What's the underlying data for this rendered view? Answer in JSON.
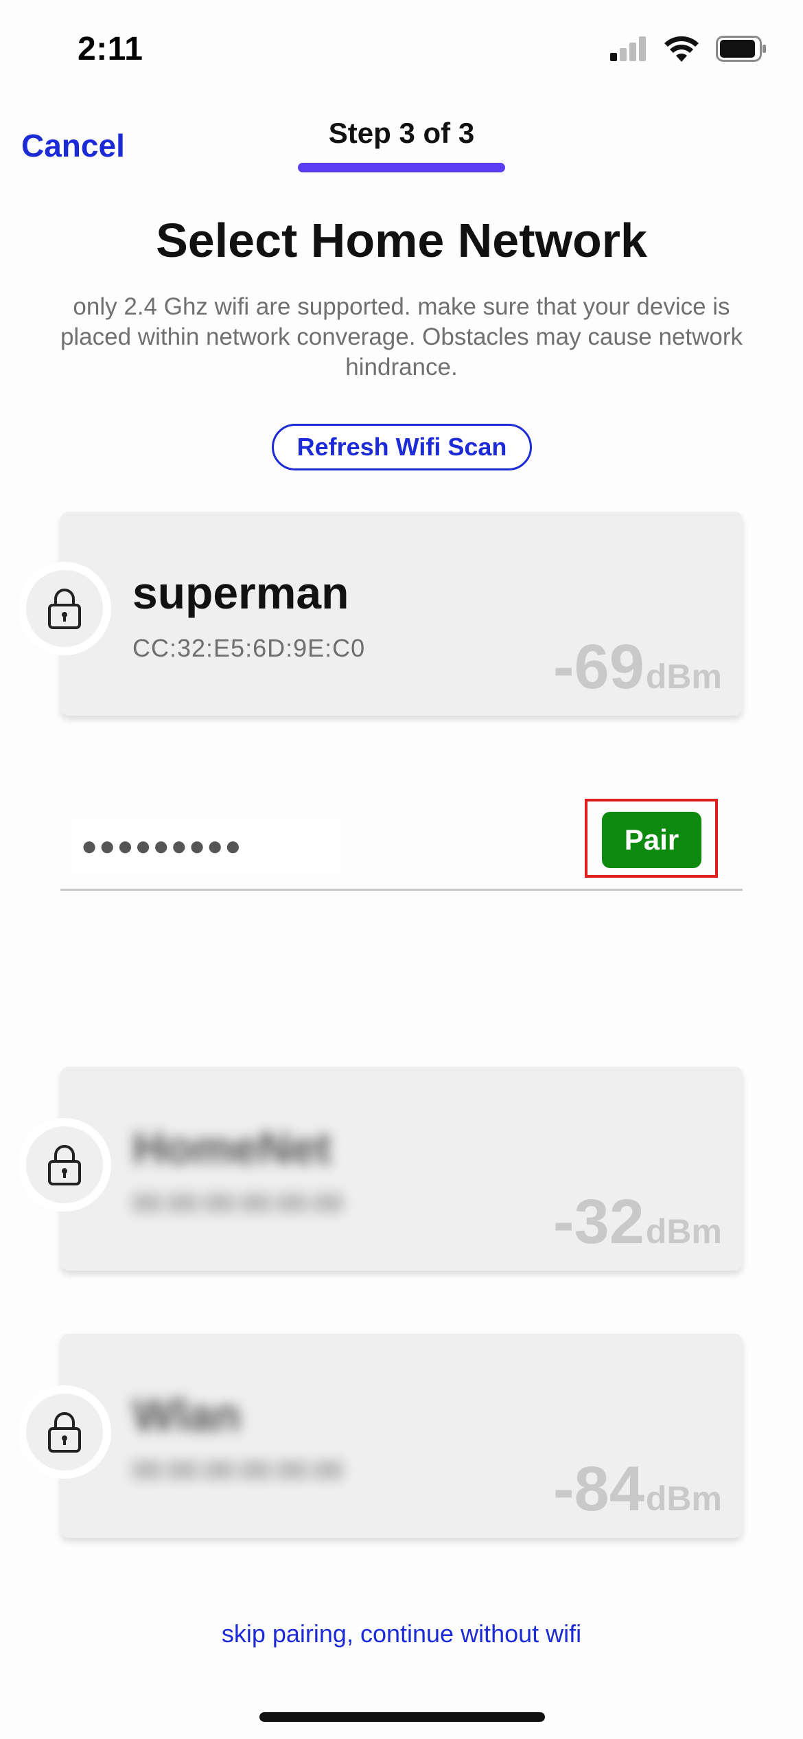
{
  "status_bar": {
    "time": "2:11",
    "icons": [
      "cellular-signal-icon",
      "wifi-icon",
      "battery-icon"
    ]
  },
  "nav": {
    "cancel_label": "Cancel",
    "step_label": "Step 3 of 3",
    "progress": 1.0,
    "accent_color": "#5a3df2"
  },
  "page": {
    "title": "Select Home Network",
    "description": "only 2.4 Ghz wifi are supported. make sure that your device is placed within network converage. Obstacles may cause network hindrance.",
    "refresh_label": "Refresh Wifi Scan"
  },
  "networks": [
    {
      "name": "superman",
      "mac": "CC:32:E5:6D:9E:C0",
      "signal": "-69",
      "unit": "dBm",
      "locked": true,
      "blurred": false
    },
    {
      "name": "HomeNet",
      "mac": "00:00:00:00:00:00",
      "signal": "-32",
      "unit": "dBm",
      "locked": true,
      "blurred": true
    },
    {
      "name": "Wlan",
      "mac": "00:00:00:00:00:00",
      "signal": "-84",
      "unit": "dBm",
      "locked": true,
      "blurred": true
    }
  ],
  "password": {
    "masked_value": "●●●●●●●●●",
    "pair_label": "Pair",
    "pair_color": "#0e8a0e"
  },
  "footer": {
    "skip_label": "skip pairing, continue without wifi"
  }
}
